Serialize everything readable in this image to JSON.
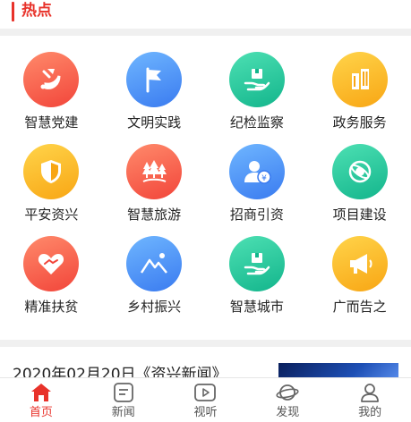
{
  "section": {
    "title": "热点"
  },
  "grid": [
    {
      "label": "智慧党建",
      "icon": "party-emblem-icon",
      "color": "red"
    },
    {
      "label": "文明实践",
      "icon": "flag-icon",
      "color": "blue"
    },
    {
      "label": "纪检监察",
      "icon": "box-in-hand-icon",
      "color": "green"
    },
    {
      "label": "政务服务",
      "icon": "building-icon",
      "color": "yellow"
    },
    {
      "label": "平安资兴",
      "icon": "shield-icon",
      "color": "yellow"
    },
    {
      "label": "智慧旅游",
      "icon": "trees-icon",
      "color": "red"
    },
    {
      "label": "招商引资",
      "icon": "investor-icon",
      "color": "blue"
    },
    {
      "label": "项目建设",
      "icon": "project-icon",
      "color": "green"
    },
    {
      "label": "精准扶贫",
      "icon": "handshake-heart-icon",
      "color": "red"
    },
    {
      "label": "乡村振兴",
      "icon": "mountain-icon",
      "color": "blue"
    },
    {
      "label": "智慧城市",
      "icon": "box-in-hand-icon",
      "color": "green"
    },
    {
      "label": "广而告之",
      "icon": "megaphone-icon",
      "color": "yellow"
    }
  ],
  "news": {
    "title": "2020年02月20日《资兴新闻》"
  },
  "tabbar": [
    {
      "label": "首页",
      "icon": "home-icon",
      "active": true
    },
    {
      "label": "新闻",
      "icon": "news-icon",
      "active": false
    },
    {
      "label": "视听",
      "icon": "video-icon",
      "active": false
    },
    {
      "label": "发现",
      "icon": "planet-icon",
      "active": false
    },
    {
      "label": "我的",
      "icon": "user-icon",
      "active": false
    }
  ],
  "colors": {
    "accent": "#e8322a",
    "red": "#f2453a",
    "blue": "#3a7bf0",
    "green": "#13b58c",
    "yellow": "#f8a614"
  }
}
